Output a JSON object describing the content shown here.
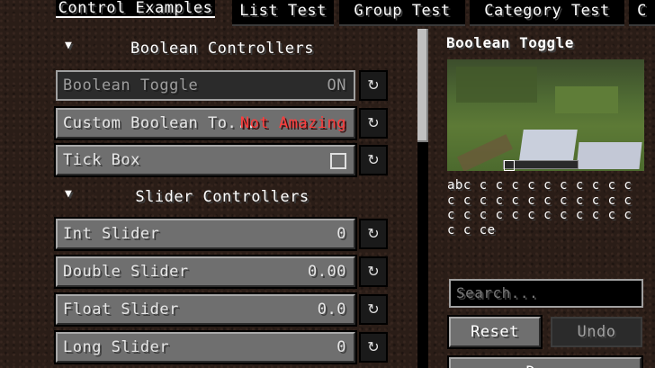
{
  "tabs": [
    {
      "label": "Control Examples",
      "active": true
    },
    {
      "label": "List Test",
      "active": false
    },
    {
      "label": "Group Test",
      "active": false
    },
    {
      "label": "Category Test",
      "active": false
    },
    {
      "label": "C",
      "active": false
    }
  ],
  "categories": {
    "boolean": {
      "title": "Boolean Controllers",
      "arrow": "▼"
    },
    "slider": {
      "title": "Slider Controllers",
      "arrow": "▼"
    }
  },
  "controls": {
    "boolean_toggle": {
      "label": "Boolean Toggle",
      "value": "ON"
    },
    "custom_boolean": {
      "label": "Custom Boolean To...",
      "value": "Not Amazing"
    },
    "tick_box": {
      "label": "Tick Box"
    },
    "int_slider": {
      "label": "Int Slider",
      "value": "0"
    },
    "double_slider": {
      "label": "Double Slider",
      "value": "0.00"
    },
    "float_slider": {
      "label": "Float Slider",
      "value": "0.0"
    },
    "long_slider": {
      "label": "Long Slider",
      "value": "0"
    }
  },
  "reset_glyph": "↻",
  "panel": {
    "title": "Boolean Toggle",
    "description": "abc c c c c c c c c c c c c c c c c c c c c c c c c c c c c c c c c c c c c ce",
    "search_placeholder": "Search...",
    "reset_label": "Reset",
    "undo_label": "Undo",
    "bottom_label": "Done"
  },
  "colors": {
    "custom_value": "#ff3b3b",
    "background": "#2a1d17"
  }
}
